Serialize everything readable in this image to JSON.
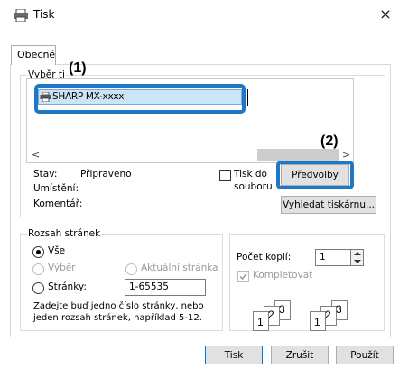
{
  "window": {
    "title": "Tisk",
    "close_glyph": "×"
  },
  "tab": {
    "label": "Obecné"
  },
  "printer_group": {
    "label": "Vyberte tiskárnu",
    "label_visible": "Vyběr ti",
    "printers": [
      {
        "name": "SHARP MX-xxxx",
        "selected": true
      }
    ]
  },
  "annotations": {
    "one": "(1)",
    "two": "(2)"
  },
  "status": {
    "state_label": "Stav:",
    "state_value": "Připraveno",
    "location_label": "Umístění:",
    "comment_label": "Komentář:"
  },
  "print_to_file": {
    "line1": "Tisk do",
    "line2": "souboru",
    "checked": false
  },
  "buttons": {
    "preferences": "Předvolby",
    "find_printer": "Vyhledat tiskárnu...",
    "print": "Tisk",
    "cancel": "Zrušit",
    "apply": "Použít"
  },
  "page_range": {
    "label": "Rozsah stránek",
    "all": "Vše",
    "selection": "Výběr",
    "current_page": "Aktuální stránka",
    "pages": "Stránky:",
    "pages_value": "1-65535",
    "hint_line1": "Zadejte buď jedno číslo stránky, nebo",
    "hint_line2": "jeden rozsah stránek, například 5-12."
  },
  "copies": {
    "label": "Počet kopií:",
    "value": "1",
    "collate": "Kompletovat",
    "collate_checked": true
  },
  "collate_preview": {
    "p1": "1",
    "p2": "2",
    "p3": "3"
  },
  "colors": {
    "annotation": "#1e78c6",
    "selection": "#cce4f7"
  }
}
